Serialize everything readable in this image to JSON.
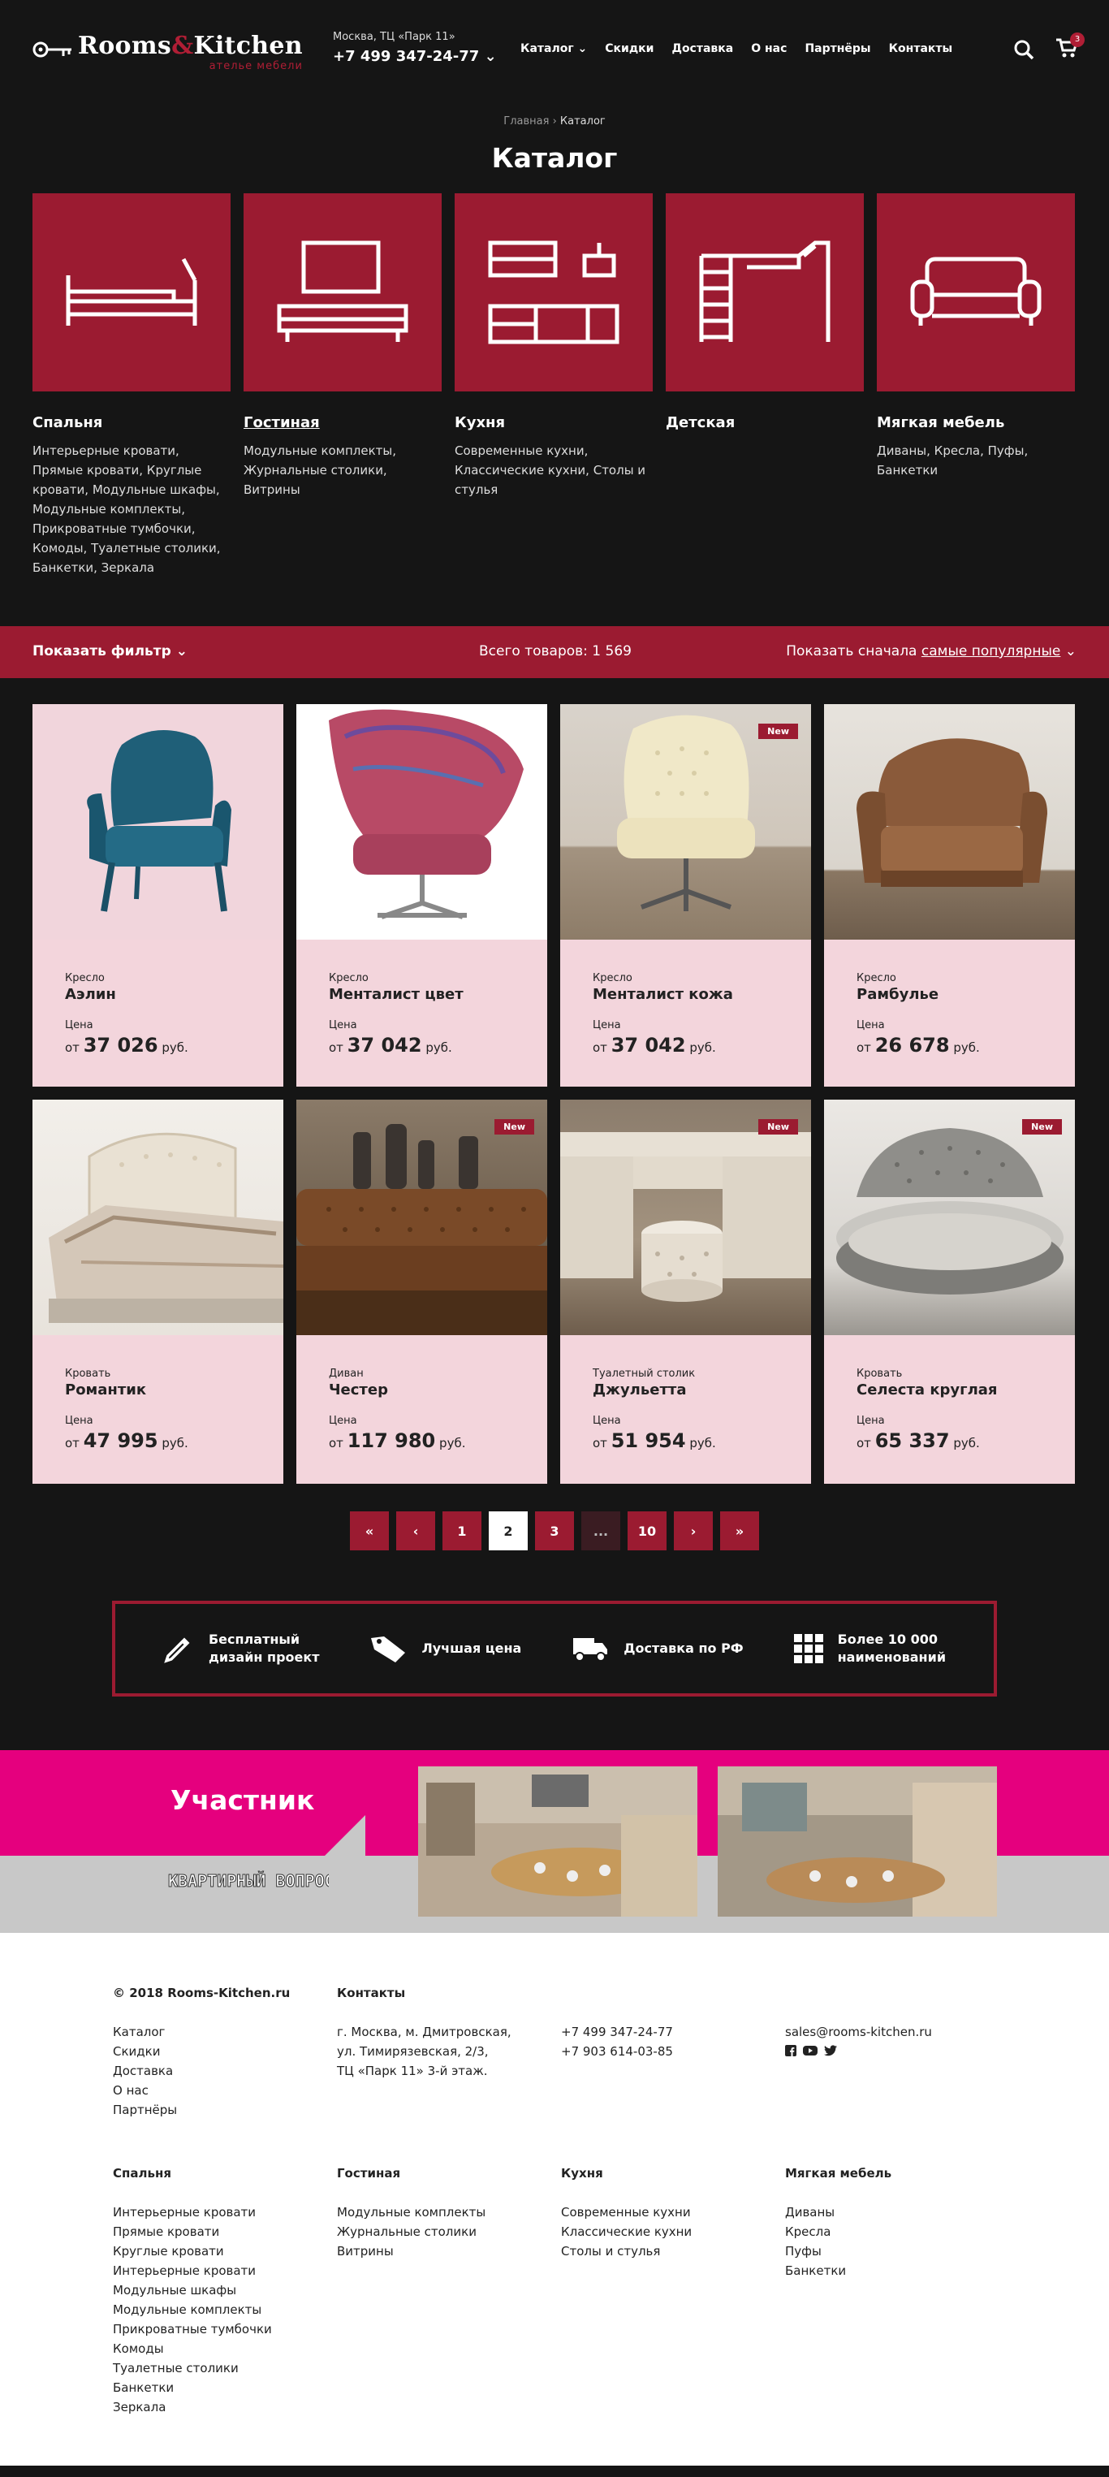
{
  "header": {
    "logo_main": "Rooms",
    "logo_amp": "&",
    "logo_second": "Kitchen",
    "logo_sub": "ателье мебели",
    "city": "Москва, ТЦ «Парк 11»",
    "phone": "+7 499 347-24-77",
    "nav": [
      "Каталог",
      "Скидки",
      "Доставка",
      "О нас",
      "Партнёры",
      "Контакты"
    ],
    "cart_count": "3"
  },
  "breadcrumb": {
    "home": "Главная",
    "current": "Каталог"
  },
  "page_title": "Каталог",
  "categories": [
    {
      "name": "Спальня",
      "links": "Интерьерные кровати, Прямые кровати, Круглые кровати, Модульные шкафы, Модульные комплекты, Прикроватные тумбочки, Комоды, Туалетные столики, Банкетки, Зеркала"
    },
    {
      "name": "Гостиная",
      "links": "Модульные комплекты, Журнальные столики, Витрины"
    },
    {
      "name": "Кухня",
      "links": "Современные кухни, Классические кухни, Столы и стулья"
    },
    {
      "name": "Детская",
      "links": ""
    },
    {
      "name": "Мягкая мебель",
      "links": "Диваны, Кресла, Пуфы, Банкетки"
    }
  ],
  "filter": {
    "show_filter": "Показать фильтр",
    "total": "Всего товаров: 1 569",
    "sort_prefix": "Показать сначала",
    "sort_value": "самые популярные"
  },
  "products": [
    {
      "type": "Кресло",
      "title": "Аэлин",
      "price_label": "Цена",
      "price_from": "от",
      "price": "37 026",
      "currency": "руб.",
      "is_new": false
    },
    {
      "type": "Кресло",
      "title": "Менталист цвет",
      "price_label": "Цена",
      "price_from": "от",
      "price": "37 042",
      "currency": "руб.",
      "is_new": false
    },
    {
      "type": "Кресло",
      "title": "Менталист кожа",
      "price_label": "Цена",
      "price_from": "от",
      "price": "37 042",
      "currency": "руб.",
      "is_new": true
    },
    {
      "type": "Кресло",
      "title": "Рамбулье",
      "price_label": "Цена",
      "price_from": "от",
      "price": "26 678",
      "currency": "руб.",
      "is_new": false
    },
    {
      "type": "Кровать",
      "title": "Романтик",
      "price_label": "Цена",
      "price_from": "от",
      "price": "47 995",
      "currency": "руб.",
      "is_new": false
    },
    {
      "type": "Диван",
      "title": "Честер",
      "price_label": "Цена",
      "price_from": "от",
      "price": "117 980",
      "currency": "руб.",
      "is_new": true
    },
    {
      "type": "Туалетный столик",
      "title": "Джульетта",
      "price_label": "Цена",
      "price_from": "от",
      "price": "51 954",
      "currency": "руб.",
      "is_new": true
    },
    {
      "type": "Кровать",
      "title": "Селеста круглая",
      "price_label": "Цена",
      "price_from": "от",
      "price": "65 337",
      "currency": "руб.",
      "is_new": true
    }
  ],
  "new_badge": "New",
  "pagination": [
    "«",
    "‹",
    "1",
    "2",
    "3",
    "...",
    "10",
    "›",
    "»"
  ],
  "pagination_active": "2",
  "features": [
    {
      "icon": "pencil-icon",
      "text_1": "Бесплатный",
      "text_2": "дизайн проект"
    },
    {
      "icon": "price-tag-icon",
      "text_1": "Лучшая цена",
      "text_2": ""
    },
    {
      "icon": "truck-icon",
      "text_1": "Доставка по РФ",
      "text_2": ""
    },
    {
      "icon": "grid-icon",
      "text_1": "Более 10 000",
      "text_2": "наименований"
    }
  ],
  "banner": {
    "label": "Участник",
    "logo_text": "КВАРТИРНЫЙ ВОПРОС"
  },
  "footer": {
    "copyright": "© 2018 Rooms-Kitchen.ru",
    "menu": [
      "Каталог",
      "Скидки",
      "Доставка",
      "О нас",
      "Партнёры"
    ],
    "contacts_title": "Контакты",
    "address": [
      "г. Москва, м. Дмитровская,",
      "ул. Тимирязевская, 2/3,",
      "ТЦ «Парк 11» 3-й этаж."
    ],
    "phones": [
      "+7 499 347-24-77",
      "+7 903 614-03-85"
    ],
    "email": "sales@rooms-kitchen.ru",
    "columns": [
      {
        "title": "Спальня",
        "items": [
          "Интерьерные кровати",
          "Прямые кровати",
          "Круглые кровати",
          "Интерьерные кровати",
          "Модульные шкафы",
          "Модульные комплекты",
          "Прикроватные тумбочки",
          "Комоды",
          "Туалетные столики",
          "Банкетки",
          "Зеркала"
        ]
      },
      {
        "title": "Гостиная",
        "items": [
          "Модульные комплекты",
          "Журнальные столики",
          "Витрины"
        ]
      },
      {
        "title": "Кухня",
        "items": [
          "Современные кухни",
          "Классические кухни",
          "Столы и стулья"
        ]
      },
      {
        "title": "Мягкая мебель",
        "items": [
          "Диваны",
          "Кресла",
          "Пуфы",
          "Банкетки"
        ]
      }
    ]
  },
  "colors": {
    "accent": "#9b1b31",
    "background": "#151515",
    "card": "#f3d5dc",
    "banner_pink": "#e5007e"
  }
}
